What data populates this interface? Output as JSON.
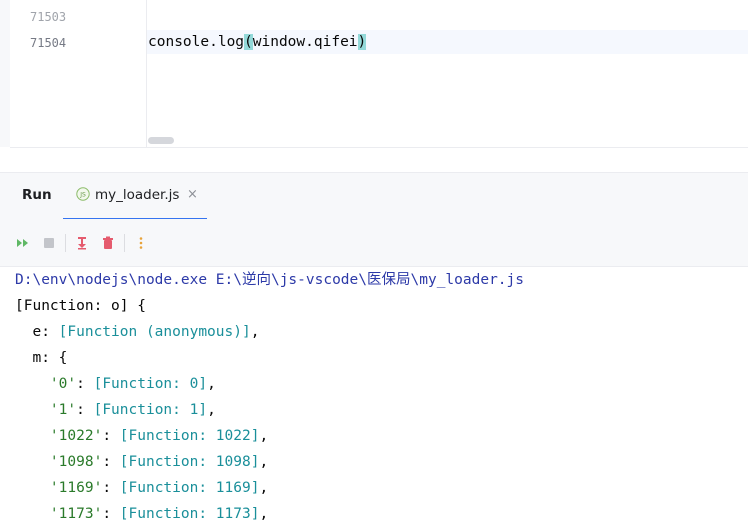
{
  "editor": {
    "lines": [
      {
        "number": "71503",
        "code": ""
      },
      {
        "number": "71504",
        "code_before": "console.log",
        "paren_open": "(",
        "code_inner": "window.qifei",
        "paren_close": ")"
      }
    ]
  },
  "run_panel": {
    "title": "Run",
    "tab": {
      "label": "my_loader.js",
      "icon": "js-file-icon",
      "close_symbol": "×"
    },
    "toolbar": {
      "rerun_icon": "rerun-icon",
      "stop_icon": "stop-icon",
      "scroll_to_end_icon": "scroll-to-end-icon",
      "clear_icon": "trash-icon",
      "more_icon": "more-vertical-icon"
    },
    "accent_color": "#3574f0"
  },
  "console": {
    "command": "D:\\env\\nodejs\\node.exe E:\\逆向\\js-vscode\\医保局\\my_loader.js",
    "line1": "[Function: o] {",
    "e_key": "  e: ",
    "e_value": "[Function (anonymous)]",
    "e_comma": ",",
    "m_line": "  m: {",
    "entries": [
      {
        "key": "'0'",
        "value": "[Function: 0]"
      },
      {
        "key": "'1'",
        "value": "[Function: 1]"
      },
      {
        "key": "'1022'",
        "value": "[Function: 1022]"
      },
      {
        "key": "'1098'",
        "value": "[Function: 1098]"
      },
      {
        "key": "'1169'",
        "value": "[Function: 1169]"
      },
      {
        "key": "'1173'",
        "value": "[Function: 1173]"
      }
    ]
  }
}
